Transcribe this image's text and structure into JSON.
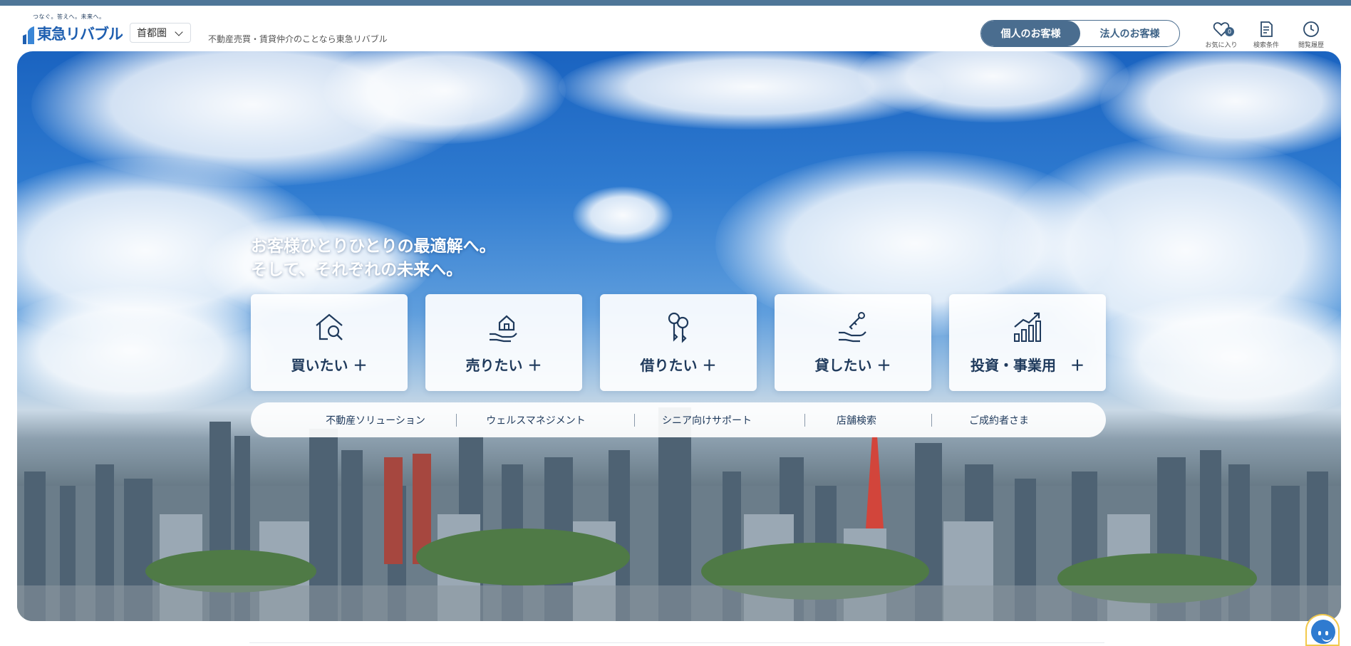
{
  "header": {
    "logo_tagline": "つなぐ。答えへ。未来へ。",
    "logo_name": "東急リバブル",
    "region": "首都圏",
    "description": "不動産売買・賃貸仲介のことなら東急リバブル",
    "customer_tabs": [
      {
        "label": "個人のお客様",
        "active": true
      },
      {
        "label": "法人のお客様",
        "active": false
      }
    ],
    "favorites": {
      "label": "お気に入り",
      "count": "0",
      "icon": "heart-icon"
    },
    "search_conditions": {
      "label": "検索条件",
      "icon": "document-icon"
    },
    "history": {
      "label": "閲覧履歴",
      "icon": "clock-icon"
    }
  },
  "hero": {
    "copy_line1": "お客様ひとりひとりの最適解へ。",
    "copy_line2": "そして、それぞれの未来へ。",
    "cards": [
      {
        "label": "買いたい ＋",
        "icon": "house-search-icon"
      },
      {
        "label": "売りたい ＋",
        "icon": "hand-house-icon"
      },
      {
        "label": "借りたい ＋",
        "icon": "keys-icon"
      },
      {
        "label": "貸したい ＋",
        "icon": "hand-key-icon"
      },
      {
        "label": "投資・事業用　＋",
        "icon": "growth-chart-icon"
      }
    ],
    "sublinks": [
      "不動産ソリューション",
      "ウェルスマネジメント",
      "シニア向けサポート",
      "店舗検索",
      "ご成約者さま"
    ]
  },
  "colors": {
    "brand_blue": "#1f5fb0",
    "nav_accent": "#4a6d8f",
    "text_navy": "#1f3a5c"
  }
}
